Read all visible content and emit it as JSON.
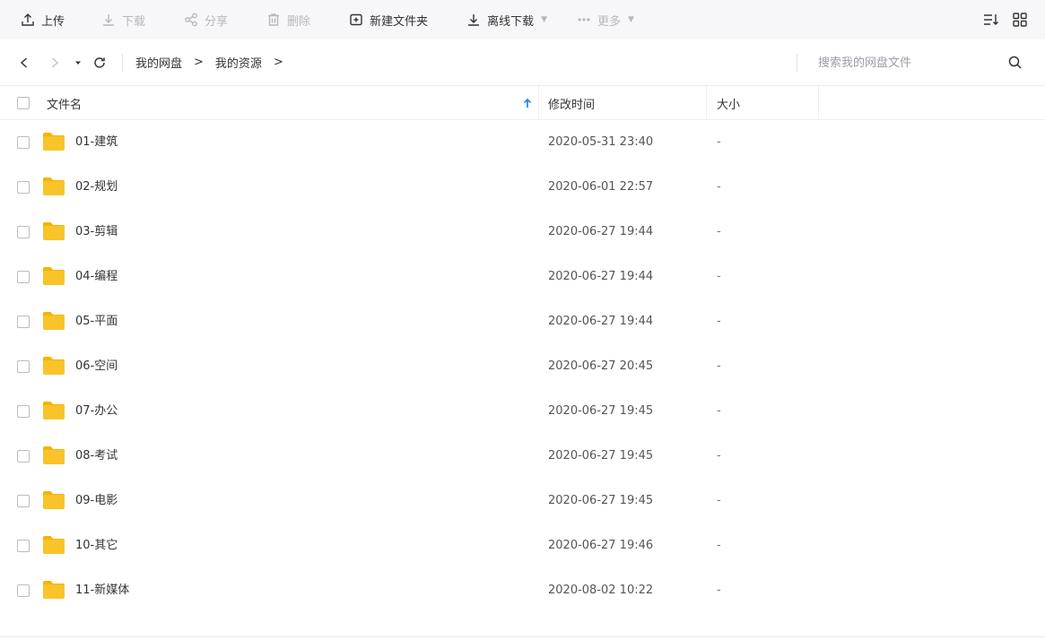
{
  "toolbar": {
    "upload": "上传",
    "download": "下载",
    "share": "分享",
    "delete": "删除",
    "new_folder": "新建文件夹",
    "offline_download": "离线下载",
    "more": "更多"
  },
  "nav": {
    "breadcrumbs": [
      "我的网盘",
      "我的资源"
    ],
    "separator": ">",
    "search_placeholder": "搜索我的网盘文件"
  },
  "table": {
    "col_name": "文件名",
    "col_modified": "修改时间",
    "col_size": "大小",
    "rows": [
      {
        "name": "01-建筑",
        "modified": "2020-05-31 23:40",
        "size": "-"
      },
      {
        "name": "02-规划",
        "modified": "2020-06-01 22:57",
        "size": "-"
      },
      {
        "name": "03-剪辑",
        "modified": "2020-06-27 19:44",
        "size": "-"
      },
      {
        "name": "04-编程",
        "modified": "2020-06-27 19:44",
        "size": "-"
      },
      {
        "name": "05-平面",
        "modified": "2020-06-27 19:44",
        "size": "-"
      },
      {
        "name": "06-空间",
        "modified": "2020-06-27 20:45",
        "size": "-"
      },
      {
        "name": "07-办公",
        "modified": "2020-06-27 19:45",
        "size": "-"
      },
      {
        "name": "08-考试",
        "modified": "2020-06-27 19:45",
        "size": "-"
      },
      {
        "name": "09-电影",
        "modified": "2020-06-27 19:45",
        "size": "-"
      },
      {
        "name": "10-其它",
        "modified": "2020-06-27 19:46",
        "size": "-"
      },
      {
        "name": "11-新媒体",
        "modified": "2020-08-02 10:22",
        "size": "-"
      }
    ]
  },
  "colors": {
    "folder": "#f8c42a",
    "folder_tab": "#f5b400",
    "sort_arrow": "#2a8bf2",
    "disabled": "#b5b8be"
  },
  "icons": {
    "upload": "upload-icon",
    "download": "download-icon",
    "share": "share-icon",
    "delete": "trash-icon",
    "new_folder": "new-folder-icon",
    "offline_download": "offline-download-icon",
    "more": "ellipsis-icon",
    "sort": "sort-list-icon",
    "grid": "grid-view-icon",
    "back": "chevron-left-icon",
    "forward": "chevron-right-icon",
    "history": "caret-down-icon",
    "refresh": "refresh-icon",
    "search": "search-icon",
    "folder": "folder-icon"
  }
}
